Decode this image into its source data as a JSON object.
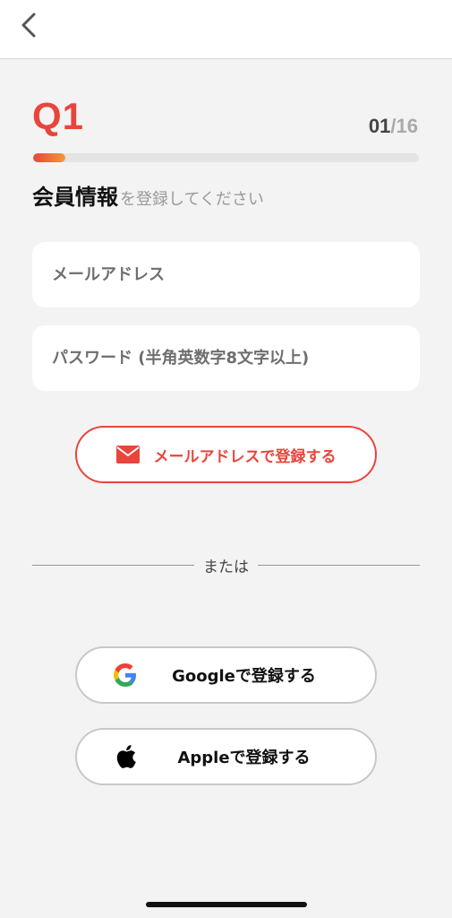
{
  "header": {
    "back_icon": "chevron-left-icon"
  },
  "question": {
    "label": "Q1",
    "step_current": "01",
    "step_separator": "/",
    "step_total": "16",
    "progress_fraction": 0.0625
  },
  "heading": {
    "main": "会員情報",
    "sub": "を登録してください"
  },
  "form": {
    "email_placeholder": "メールアドレス",
    "password_placeholder": "パスワード (半角英数字8文字以上)",
    "email_signup_label": "メールアドレスで登録する",
    "email_signup_icon": "envelope-icon"
  },
  "divider": {
    "label": "または"
  },
  "social": {
    "google_label": "Googleで登録する",
    "google_icon": "google-icon",
    "apple_label": "Appleで登録する",
    "apple_icon": "apple-icon"
  },
  "colors": {
    "accent": "#e8453c",
    "progress_end": "#f39a3a",
    "background": "#f3f3f3"
  }
}
